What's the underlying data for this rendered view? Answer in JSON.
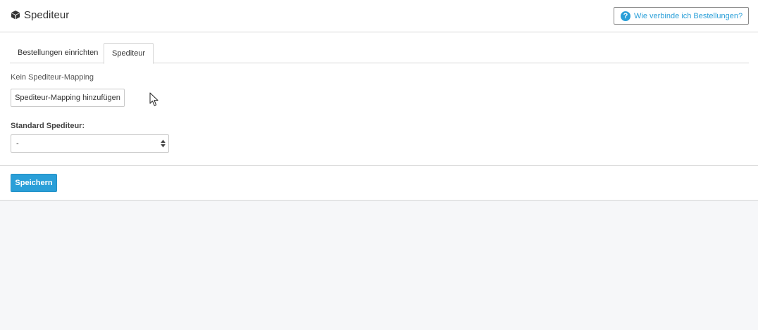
{
  "header": {
    "title": "Spediteur",
    "title_icon": "cube-icon",
    "help_button": {
      "label": "Wie verbinde ich Bestellungen?",
      "icon": "question-circle-icon"
    }
  },
  "tabs": [
    {
      "label": "Bestellungen einrichten",
      "active": false
    },
    {
      "label": "Spediteur",
      "active": true
    }
  ],
  "mapping": {
    "empty_text": "Kein Spediteur-Mapping",
    "add_button_label": "Spediteur-Mapping hinzufügen"
  },
  "standard": {
    "label": "Standard Spediteur:",
    "selected_value": "-"
  },
  "footer": {
    "save_label": "Speichern"
  },
  "colors": {
    "accent": "#2a9fd8",
    "border": "#d6d6d6",
    "background": "#f6f7f9"
  }
}
